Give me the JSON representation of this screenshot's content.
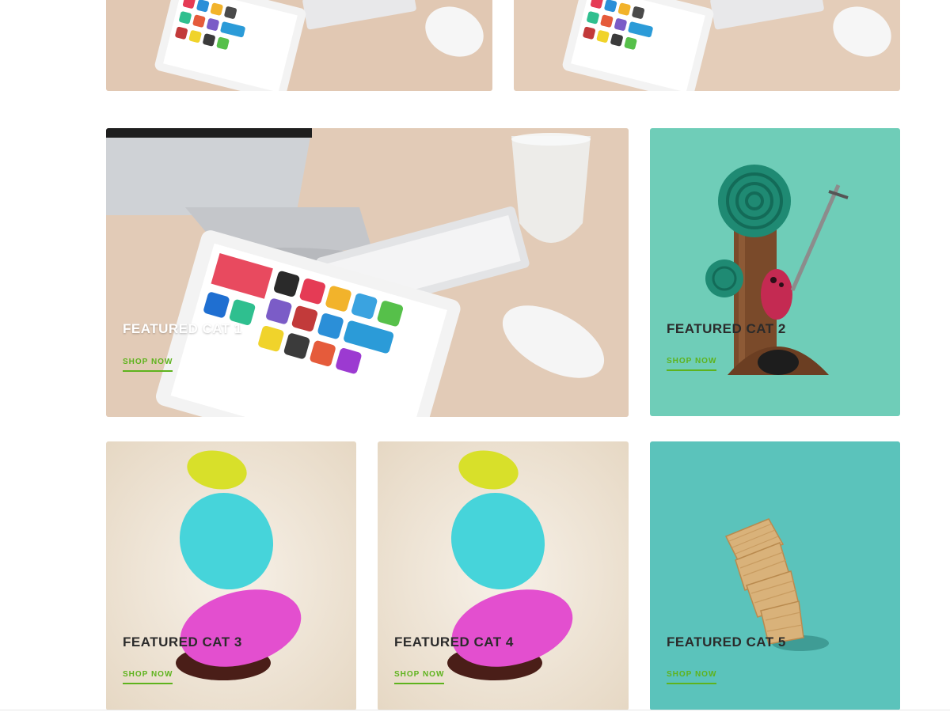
{
  "colors": {
    "accent": "#5eb31d",
    "wood": "#e3c9b4",
    "mint": "#6fcdb8",
    "teal": "#5bc3bb",
    "cream": "#ede3d6"
  },
  "top_row": [
    {
      "image": "tablet-and-mouse-photo"
    },
    {
      "image": "tablet-and-mouse-photo"
    }
  ],
  "categories": [
    {
      "title": "FEATURED CAT 1",
      "link": "SHOP NOW",
      "image": "desk-with-imac-tablet-keyboard-photo"
    },
    {
      "title": "FEATURED CAT 2",
      "link": "SHOP NOW",
      "image": "illustrated-tree-and-monster"
    },
    {
      "title": "FEATURED CAT 3",
      "link": "SHOP NOW",
      "image": "stacked-colorful-stones"
    },
    {
      "title": "FEATURED CAT 4",
      "link": "SHOP NOW",
      "image": "stacked-colorful-stones"
    },
    {
      "title": "FEATURED CAT 5",
      "link": "SHOP NOW",
      "image": "stack-of-crackers"
    }
  ]
}
